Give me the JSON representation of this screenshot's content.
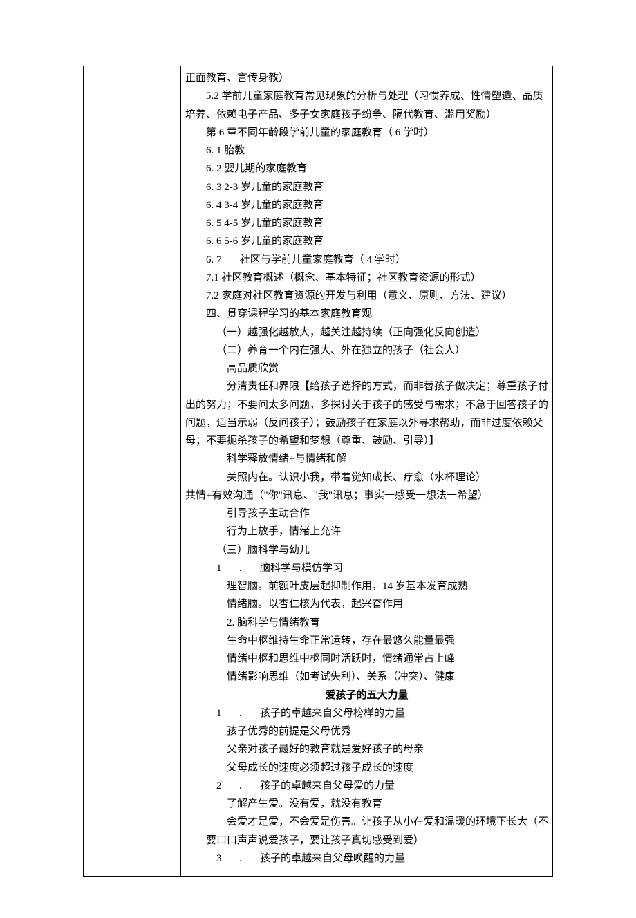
{
  "lines": [
    {
      "cls": "ind-0",
      "text": "正面教育、言传身教）"
    },
    {
      "cls": "ind-1",
      "text": "5.2 学前儿童家庭教育常见现象的分析与处理（习惯养成、性情塑造、品质"
    },
    {
      "cls": "ind-0",
      "text": "培养、依赖电子产品、多子女家庭孩子纷争、隔代教育、滥用奖励）"
    },
    {
      "cls": "ind-1",
      "text": "第 6 章不同年龄段学前儿童的家庭教育（ 6 学时）"
    },
    {
      "cls": "ind-1",
      "text": "6. 1 胎教"
    },
    {
      "cls": "ind-1",
      "text": "6. 2 婴儿期的家庭教育"
    },
    {
      "cls": "ind-1",
      "text": "6. 3 2-3 岁儿童的家庭教育"
    },
    {
      "cls": "ind-1",
      "text": "6. 4 3-4 岁儿童的家庭教育"
    },
    {
      "cls": "ind-1",
      "text": "6. 5 4-5 岁儿童的家庭教育"
    },
    {
      "cls": "ind-1",
      "text": "6. 6 5-6 岁儿童的家庭教育"
    },
    {
      "cls": "ind-1",
      "text": "6. 7       社区与学前儿童家庭教育（ 4 学时）"
    },
    {
      "cls": "ind-1",
      "text": "7.1 社区教育概述（概念、基本特征；社区教育资源的形式）"
    },
    {
      "cls": "ind-1",
      "text": "7.2 家庭对社区教育资源的开发与利用（意义、原则、方法、建议）"
    },
    {
      "cls": "ind-1",
      "text": "四、贯穿课程学习的基本家庭教育观"
    },
    {
      "cls": "ind-2",
      "text": "（一）越强化越放大，越关注越持续（正向强化反向创造）"
    },
    {
      "cls": "ind-2",
      "text": "（二）养育一个内在强大、外在独立的孩子（社会人）"
    },
    {
      "cls": "ind-3",
      "text": "高品质欣赏"
    },
    {
      "cls": "ind-3",
      "text": "分清责任和界限【给孩子选择的方式，而非替孩子做决定；尊重孩子付"
    },
    {
      "cls": "ind-0",
      "text": "出的努力；不要问太多问题，多探讨关于孩子的感受与需求；不急于回答孩子的"
    },
    {
      "cls": "ind-0",
      "text": "问题，适当示弱（反问孩子）；鼓励孩子在家庭以外寻求帮助，而非过度依赖父"
    },
    {
      "cls": "ind-0",
      "text": "母；不要扼杀孩子的希望和梦想（尊重、鼓励、引导）】"
    },
    {
      "cls": "ind-3",
      "text": "科学释放情绪+与情绪和解"
    },
    {
      "cls": "ind-3",
      "text": "关照内在。认识小我，带着觉知成长、疗愈（水杯理论）"
    },
    {
      "cls": "ind-0",
      "text": "共情+有效沟通（\"你\"讯息、\"我\"讯息；事实一感受一想法一希望）"
    },
    {
      "cls": "ind-3",
      "text": "引导孩子主动合作"
    },
    {
      "cls": "ind-3",
      "text": "行为上放手，情绪上允许"
    },
    {
      "cls": "ind-2",
      "text": "（三）脑科学与幼儿"
    },
    {
      "cls": "ind-2 num-gap",
      "num": "1",
      "sep": ".",
      "text": "脑科学与模仿学习"
    },
    {
      "cls": "ind-3",
      "text": "理智脑。前额叶皮层起抑制作用，14 岁基本发育成熟"
    },
    {
      "cls": "ind-3",
      "text": "情绪脑。以杏仁核为代表，起兴奋作用"
    },
    {
      "cls": "ind-3",
      "text": "2. 脑科学与情绪教育"
    },
    {
      "cls": "ind-3",
      "text": "生命中枢维持生命正常运转，存在最悠久能量最强"
    },
    {
      "cls": "ind-3",
      "text": "情绪中枢和思维中枢同时活跃时，情绪通常占上峰"
    },
    {
      "cls": "ind-3",
      "text": "情绪影响思维（如考试失利）、关系（冲突）、健康"
    },
    {
      "cls": "center",
      "text": "爱孩子的五大力量"
    },
    {
      "cls": "ind-2 num-gap",
      "num": "1",
      "sep": ".",
      "text": "孩子的卓越来自父母榜样的力量"
    },
    {
      "cls": "ind-3",
      "text": "孩子优秀的前提是父母优秀"
    },
    {
      "cls": "ind-3",
      "text": "父亲对孩子最好的教育就是爱好孩子的母亲"
    },
    {
      "cls": "ind-3",
      "text": "父母成长的速度必须超过孩子成长的速度"
    },
    {
      "cls": "ind-2 num-gap",
      "num": "2",
      "sep": ".",
      "text": "孩子的卓越来自父母爱的力量"
    },
    {
      "cls": "ind-3",
      "text": "了解产生爱。没有爱，就没有教育"
    },
    {
      "cls": "ind-3",
      "text": "会爱才是爱，不会爱是伤害。让孩子从小在爱和温暖的环境下长大（不"
    },
    {
      "cls": "ind-1",
      "text": "要口口声声说爱孩子，要让孩子真切感受到爱）"
    },
    {
      "cls": "ind-2 num-gap",
      "num": "3",
      "sep": ".",
      "text": "孩子的卓越来自父母唤醒的力量"
    }
  ]
}
